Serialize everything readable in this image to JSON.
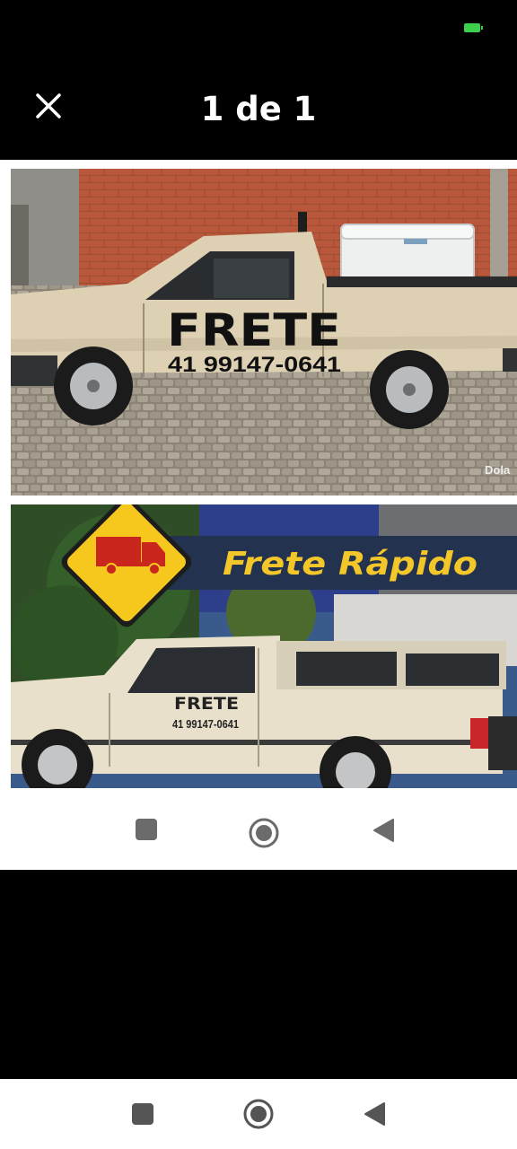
{
  "header": {
    "page_counter": "1 de 1",
    "close_icon": "close-icon"
  },
  "status_bar": {
    "battery_icon": "battery-icon",
    "battery_color": "#3ccf4e"
  },
  "image": {
    "top_photo": {
      "sign_title": "FRETE",
      "phone": "41 99147-0641",
      "watermark": "Dola"
    },
    "bottom_photo": {
      "banner_text": "Frete Rápido",
      "door_title": "FRETE",
      "door_phone": "41 99147-0641",
      "sign_icon": "truck-icon",
      "colors": {
        "sign_yellow": "#f6c81e",
        "banner_yellow": "#f3c62a",
        "truck_red": "#c9261d"
      }
    }
  },
  "inner_nav": {
    "icons": [
      "recents-icon",
      "home-icon",
      "back-icon"
    ]
  },
  "system_nav": {
    "icons": [
      "recents-icon",
      "home-icon",
      "back-icon"
    ]
  }
}
